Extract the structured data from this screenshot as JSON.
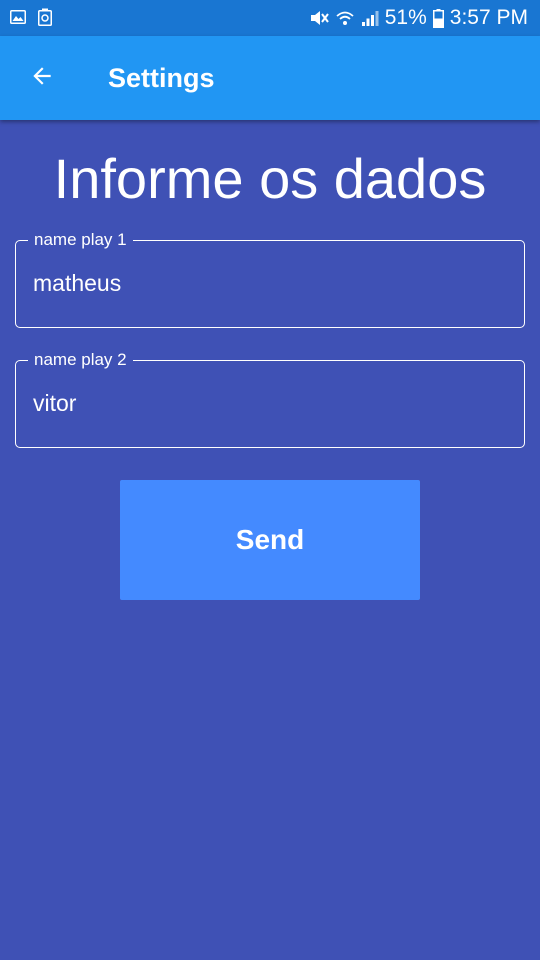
{
  "status_bar": {
    "icons_left": [
      "image-icon",
      "recycle-icon"
    ],
    "icons_right": [
      "mute-icon",
      "wifi-icon",
      "signal-icon",
      "battery-icon"
    ],
    "battery": "51%",
    "time": "3:57 PM"
  },
  "app_bar": {
    "back_icon": "arrow-back-icon",
    "title": "Settings"
  },
  "main": {
    "heading": "Informe os dados",
    "fields": [
      {
        "label": "name play 1",
        "value": "matheus"
      },
      {
        "label": "name play 2",
        "value": "vitor"
      }
    ],
    "send_label": "Send"
  },
  "colors": {
    "status_bar": "#1976d2",
    "app_bar": "#2196f3",
    "background": "#3f51b5",
    "button": "#448aff",
    "text": "#ffffff"
  }
}
